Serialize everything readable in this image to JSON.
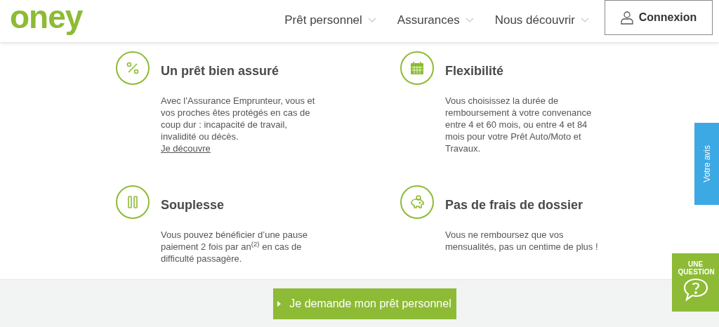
{
  "header": {
    "logo": "oney",
    "nav": [
      "Prêt personnel",
      "Assurances",
      "Nous découvrir"
    ],
    "login": "Connexion"
  },
  "features": [
    {
      "kind": "percent",
      "title": "Un prêt bien assuré",
      "text": "Avec l’Assurance Emprunteur, vous et vos proches êtes protégés en cas de coup dur : incapacité de travail, invalidité ou décès.",
      "link": "Je découvre"
    },
    {
      "kind": "calendar",
      "title": "Flexibilité",
      "text": "Vous choisissez la durée de remboursement à votre convenance entre 4 et 60 mois, ou entre 4 et 84 mois pour votre Prêt Auto/Moto et Travaux."
    },
    {
      "kind": "pause",
      "title": "Souplesse",
      "text": "Vous pouvez bénéficier d’une pause paiement 2 fois par an$^{(2)}$ en cas de difficulté passagère."
    },
    {
      "kind": "piggy",
      "title": "Pas de frais de dossier",
      "text": "Vous ne remboursez que vos mensualités, pas un centime de plus !"
    }
  ],
  "feedback_tab": "Votre avis",
  "question_widget": "UNE QUESTION",
  "cta": "Je demande mon prêt personnel"
}
